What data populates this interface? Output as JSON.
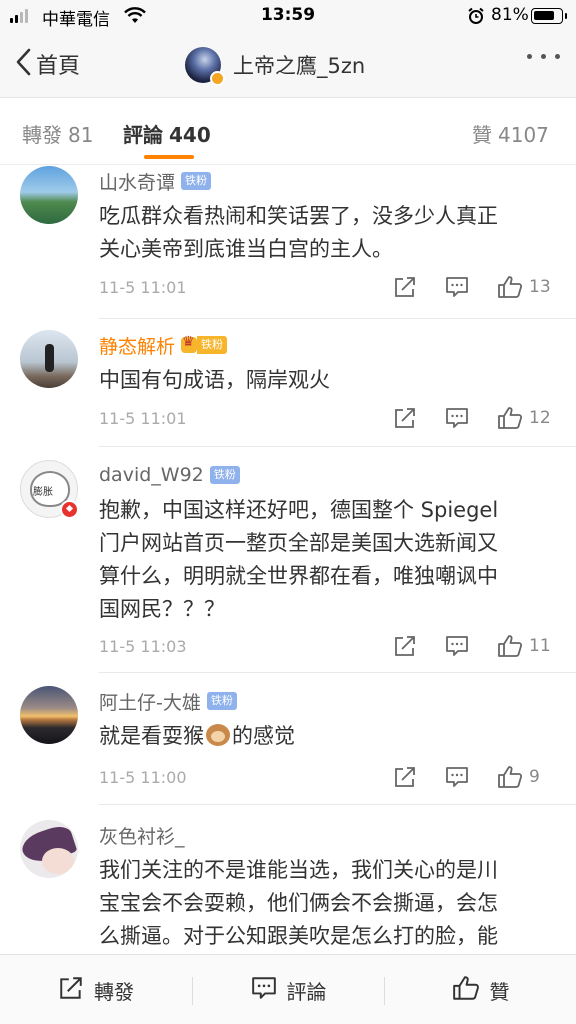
{
  "status_bar": {
    "carrier": "中華電信",
    "time": "13:59",
    "battery_percent": "81%",
    "battery_level": 0.81,
    "signal_bars_filled": 2,
    "signal_bars_total": 4
  },
  "nav": {
    "back_label": "首頁",
    "title": "上帝之鷹_5zn",
    "icons": [
      "chevron-left-icon",
      "verified-badge-icon",
      "more-dots-icon"
    ]
  },
  "tabs": {
    "repost": {
      "label": "轉發",
      "count": "81"
    },
    "comments": {
      "label": "評論",
      "count": "440"
    },
    "likes": {
      "label": "贊",
      "count": "4107"
    },
    "active": "comments",
    "accent": "#ff8200"
  },
  "comments": [
    {
      "username": "山水奇谭",
      "badge": "铁粉",
      "text_lines": [
        "吃瓜群众看热闹和笑话罢了，没多少人真正",
        "关心美帝到底谁当白宫的主人。"
      ],
      "time": "11-5 11:01",
      "likes": "13"
    },
    {
      "username": "静态解析",
      "badge": "铁粉",
      "vip": true,
      "text_lines": [
        "中国有句成语，隔岸观火"
      ],
      "time": "11-5 11:01",
      "likes": "12"
    },
    {
      "username": "david_W92",
      "badge": "铁粉",
      "avatar_text": "膨胀",
      "text_lines": [
        "抱歉，中国这样还好吧，德国整个 Spiegel",
        "门户网站首页一整页全部是美国大选新闻又",
        "算什么，明明就全世界都在看，唯独嘲讽中",
        "国网民？？？"
      ],
      "time": "11-5 11:03",
      "likes": "11"
    },
    {
      "username": "阿土仔-大雄",
      "badge": "铁粉",
      "text_before_emoji": "就是看耍猴",
      "emoji": "monkey-emoji",
      "text_after_emoji": "的感觉",
      "time": "11-5 11:00",
      "likes": "9"
    },
    {
      "username": "灰色衬衫_",
      "text_lines": [
        "我们关注的不是谁能当选，我们关心的是川",
        "宝宝会不会耍赖，他们俩会不会撕逼，会怎",
        "么撕逼。对于公知跟美吹是怎么打的脸，能"
      ]
    }
  ],
  "toolbar": {
    "repost_label": "轉發",
    "comment_label": "評論",
    "like_label": "贊"
  },
  "colors": {
    "accent": "#ff8200",
    "fan_badge": "#8fb1ec",
    "vip_badge": "#f7b52c",
    "text_primary": "#333333",
    "text_secondary": "#aaaaaa"
  }
}
